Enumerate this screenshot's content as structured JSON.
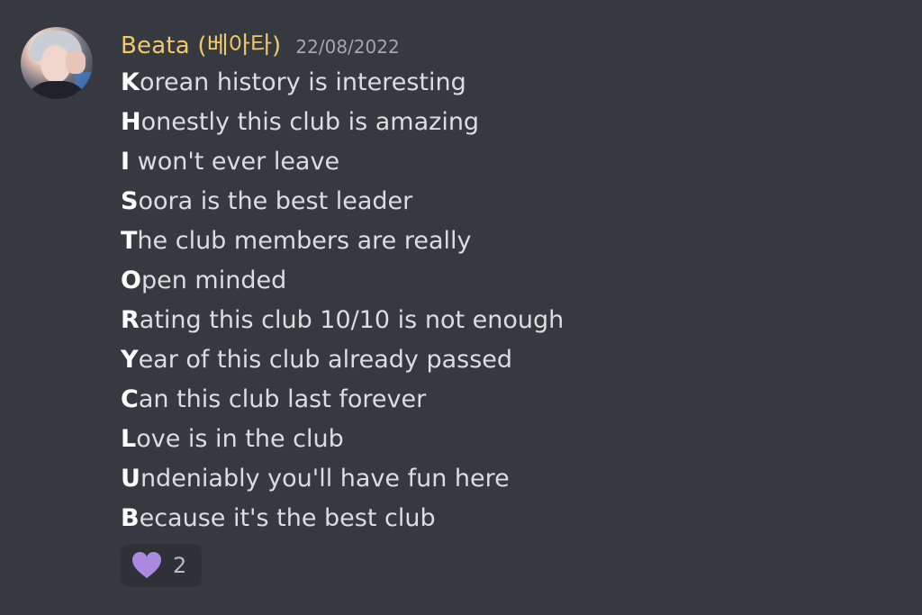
{
  "message": {
    "author": "Beata (베아타)",
    "timestamp": "22/08/2022",
    "lines": [
      {
        "initial": "K",
        "rest": "orean history is interesting"
      },
      {
        "initial": "H",
        "rest": "onestly this club is amazing"
      },
      {
        "initial": "I",
        "rest": " won't ever leave"
      },
      {
        "initial": "S",
        "rest": "oora is the best leader"
      },
      {
        "initial": "T",
        "rest": "he club members are really"
      },
      {
        "initial": "O",
        "rest": "pen minded"
      },
      {
        "initial": "R",
        "rest": "ating this club 10/10 is not enough"
      },
      {
        "initial": "Y",
        "rest": "ear of this club already passed"
      },
      {
        "initial": "C",
        "rest": "an this club last forever"
      },
      {
        "initial": "L",
        "rest": "ove is in the club"
      },
      {
        "initial": "U",
        "rest": "ndeniably you'll have fun here"
      },
      {
        "initial": "B",
        "rest": "ecause it's the best club"
      }
    ],
    "reaction": {
      "icon": "purple-heart-icon",
      "count": "2",
      "color": "#a98ae0"
    }
  },
  "colors": {
    "background": "#36393f",
    "username": "#f0c96a",
    "timestamp": "#a3a6aa",
    "text": "#dcddde",
    "reaction_bg": "#2f3136"
  }
}
